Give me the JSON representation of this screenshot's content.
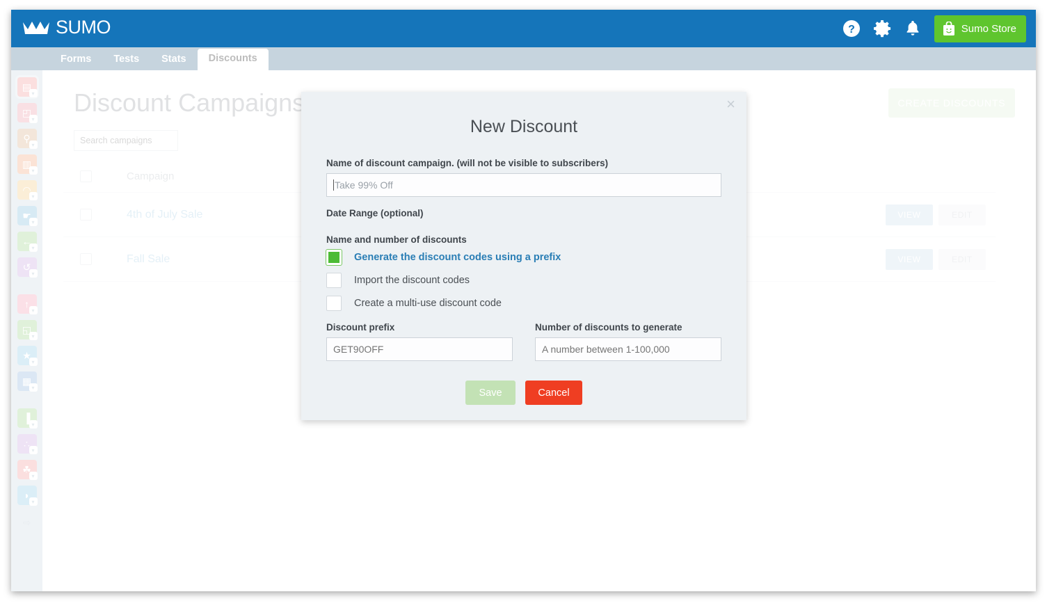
{
  "header": {
    "brand": "SUMO",
    "icons": [
      {
        "name": "help-icon",
        "glyph": "?"
      },
      {
        "name": "gear-icon",
        "glyph": "gear"
      },
      {
        "name": "bell-icon",
        "glyph": "bell"
      }
    ],
    "store_button": "Sumo Store"
  },
  "tabs": [
    {
      "label": "Forms",
      "active": false
    },
    {
      "label": "Tests",
      "active": false
    },
    {
      "label": "Stats",
      "active": false
    },
    {
      "label": "Discounts",
      "active": true
    }
  ],
  "sidebar": {
    "groups": [
      [
        {
          "name": "list-builder-icon",
          "color": "#ef8e8e",
          "glyph": "▤",
          "selected": true
        },
        {
          "name": "welcome-mat-icon",
          "color": "#e98f9e",
          "glyph": "◰",
          "selected": false
        },
        {
          "name": "scroll-box-icon",
          "color": "#d2a77b",
          "glyph": "⚲",
          "selected": false
        },
        {
          "name": "smart-bar-icon",
          "color": "#ef9a6e",
          "glyph": "▥",
          "selected": false
        },
        {
          "name": "highlighter-icon",
          "color": "#efc071",
          "glyph": "◠",
          "selected": false
        },
        {
          "name": "click-triggers-icon",
          "color": "#6fb5d8",
          "glyph": "☛",
          "selected": false
        },
        {
          "name": "image-sharer-icon",
          "color": "#8fce7a",
          "glyph": "←",
          "selected": false
        },
        {
          "name": "share-icon",
          "color": "#c09ada",
          "glyph": "↺",
          "selected": false
        }
      ],
      [
        {
          "name": "discounts-icon",
          "color": "#ef8fa8",
          "glyph": "↑",
          "selected": false
        },
        {
          "name": "contact-form-icon",
          "color": "#8fce7a",
          "glyph": "◱",
          "selected": false
        },
        {
          "name": "reviews-icon",
          "color": "#7fc3e0",
          "glyph": "★",
          "selected": false
        },
        {
          "name": "shortcuts-icon",
          "color": "#7fa8d8",
          "glyph": "▦",
          "selected": false
        }
      ],
      [
        {
          "name": "analytics-icon",
          "color": "#8fce7a",
          "glyph": "▐",
          "selected": false
        },
        {
          "name": "heat-maps-icon",
          "color": "#c09ada",
          "glyph": "∴",
          "selected": false
        },
        {
          "name": "content-analytics-icon",
          "color": "#ef8e8e",
          "glyph": "☘",
          "selected": false
        },
        {
          "name": "visitor-icon",
          "color": "#7fc3e0",
          "glyph": "◗",
          "selected": false
        }
      ]
    ],
    "collapse_glyph": "⇨"
  },
  "page": {
    "title": "Discount Campaigns",
    "search_placeholder": "Search campaigns",
    "create_button": "CREATE DISCOUNTS",
    "table": {
      "columns": [
        "Campaign"
      ],
      "rows": [
        {
          "name": "4th of July Sale",
          "view": "VIEW",
          "edit": "EDIT"
        },
        {
          "name": "Fall Sale",
          "view": "VIEW",
          "edit": "EDIT"
        }
      ]
    }
  },
  "modal": {
    "title": "New Discount",
    "close_glyph": "×",
    "name_label": "Name of discount campaign. (will not be visible to subscribers)",
    "name_placeholder": "Take 99% Off",
    "date_range_label": "Date Range (optional)",
    "options_label": "Name and number of discounts",
    "options": [
      {
        "label": "Generate the discount codes using a prefix",
        "checked": true
      },
      {
        "label": "Import the discount codes",
        "checked": false
      },
      {
        "label": "Create a multi-use discount code",
        "checked": false
      }
    ],
    "prefix_label": "Discount prefix",
    "prefix_placeholder": "GET90OFF",
    "count_label": "Number of discounts to generate",
    "count_placeholder": "A number between 1-100,000",
    "save_button": "Save",
    "cancel_button": "Cancel"
  },
  "colors": {
    "header_blue": "#1575ba",
    "store_green": "#5fc52e",
    "checkbox_green": "#4cbb35",
    "cancel_red": "#ef3e22",
    "sidebar_gray": "#c6d4de",
    "modal_bg": "#edf1f4"
  }
}
